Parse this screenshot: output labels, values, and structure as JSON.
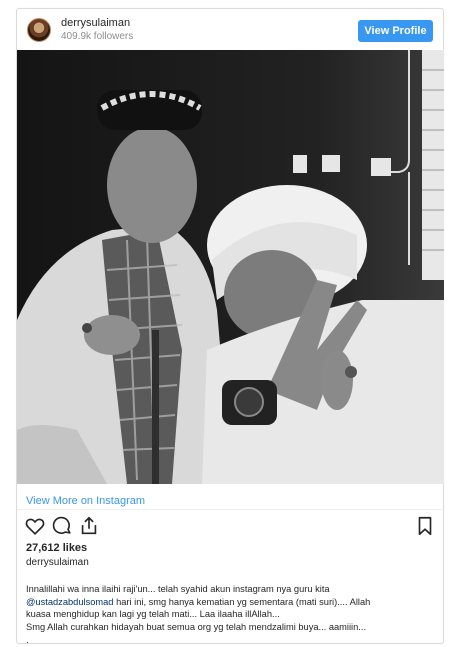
{
  "post": {
    "username": "derrysulaiman",
    "followers": "409.9k followers",
    "view_profile_label": "View Profile",
    "view_more_label": "View More on Instagram",
    "likes": "27,612 likes",
    "caption_username": "derrysulaiman",
    "caption": {
      "line1": "Innalillahi wa inna ilaihi raji'un... telah syahid akun instagram nya guru kita",
      "mention": "@ustadzabdulsomad",
      "line2_rest": " hari ini, smg hanya kematian yg sementara (mati suri).... Allah",
      "line3": "kuasa menghidup kan lagi yg telah mati... Laa ilaaha illAllah...",
      "line4": "Smg Allah curahkan hidayah buat semua org yg telah mendzalimi buya... aamiiin...",
      "line5": "."
    }
  },
  "icons": {
    "avatar": "profile-photo",
    "like": "heart-outline-icon",
    "comment": "comment-bubble-icon",
    "share": "share-icon",
    "save": "bookmark-icon"
  },
  "colors": {
    "button_blue": "#3897f0",
    "link_blue": "#3897f0",
    "mention": "#003569",
    "text": "#262626",
    "muted": "#8e8e8e",
    "border": "#dbdbdb"
  }
}
